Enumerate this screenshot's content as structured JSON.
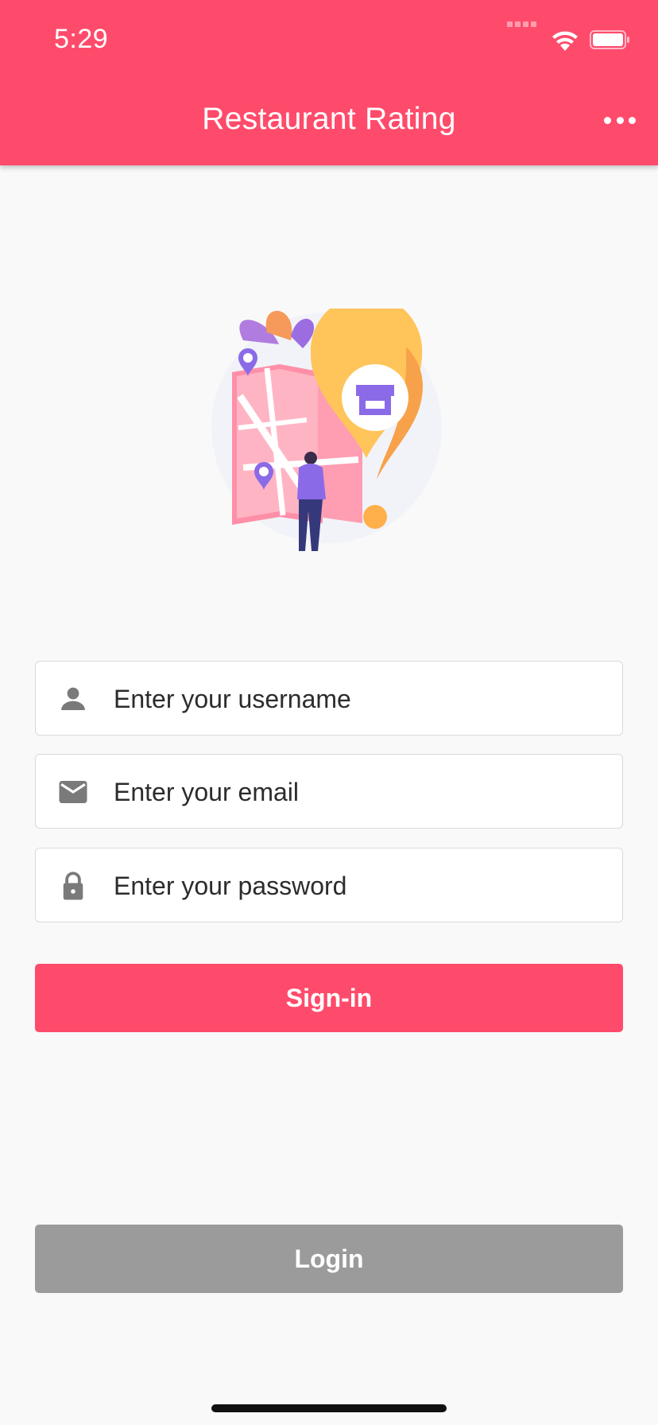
{
  "status_bar": {
    "time": "5:29"
  },
  "app_bar": {
    "title": "Restaurant Rating",
    "menu_icon": "more-horizontal-icon"
  },
  "illustration": {
    "subject": "map-location-pin-illustration"
  },
  "form": {
    "username": {
      "placeholder": "Enter your username",
      "icon": "person-icon"
    },
    "email": {
      "placeholder": "Enter your email",
      "icon": "mail-icon"
    },
    "password": {
      "placeholder": "Enter your password",
      "icon": "lock-icon"
    }
  },
  "buttons": {
    "signin_label": "Sign-in",
    "login_label": "Login"
  },
  "colors": {
    "primary": "#ff4b6b",
    "secondary_button": "#9b9b9b",
    "background": "#f9f9f9",
    "icon": "#7a7a7a"
  }
}
